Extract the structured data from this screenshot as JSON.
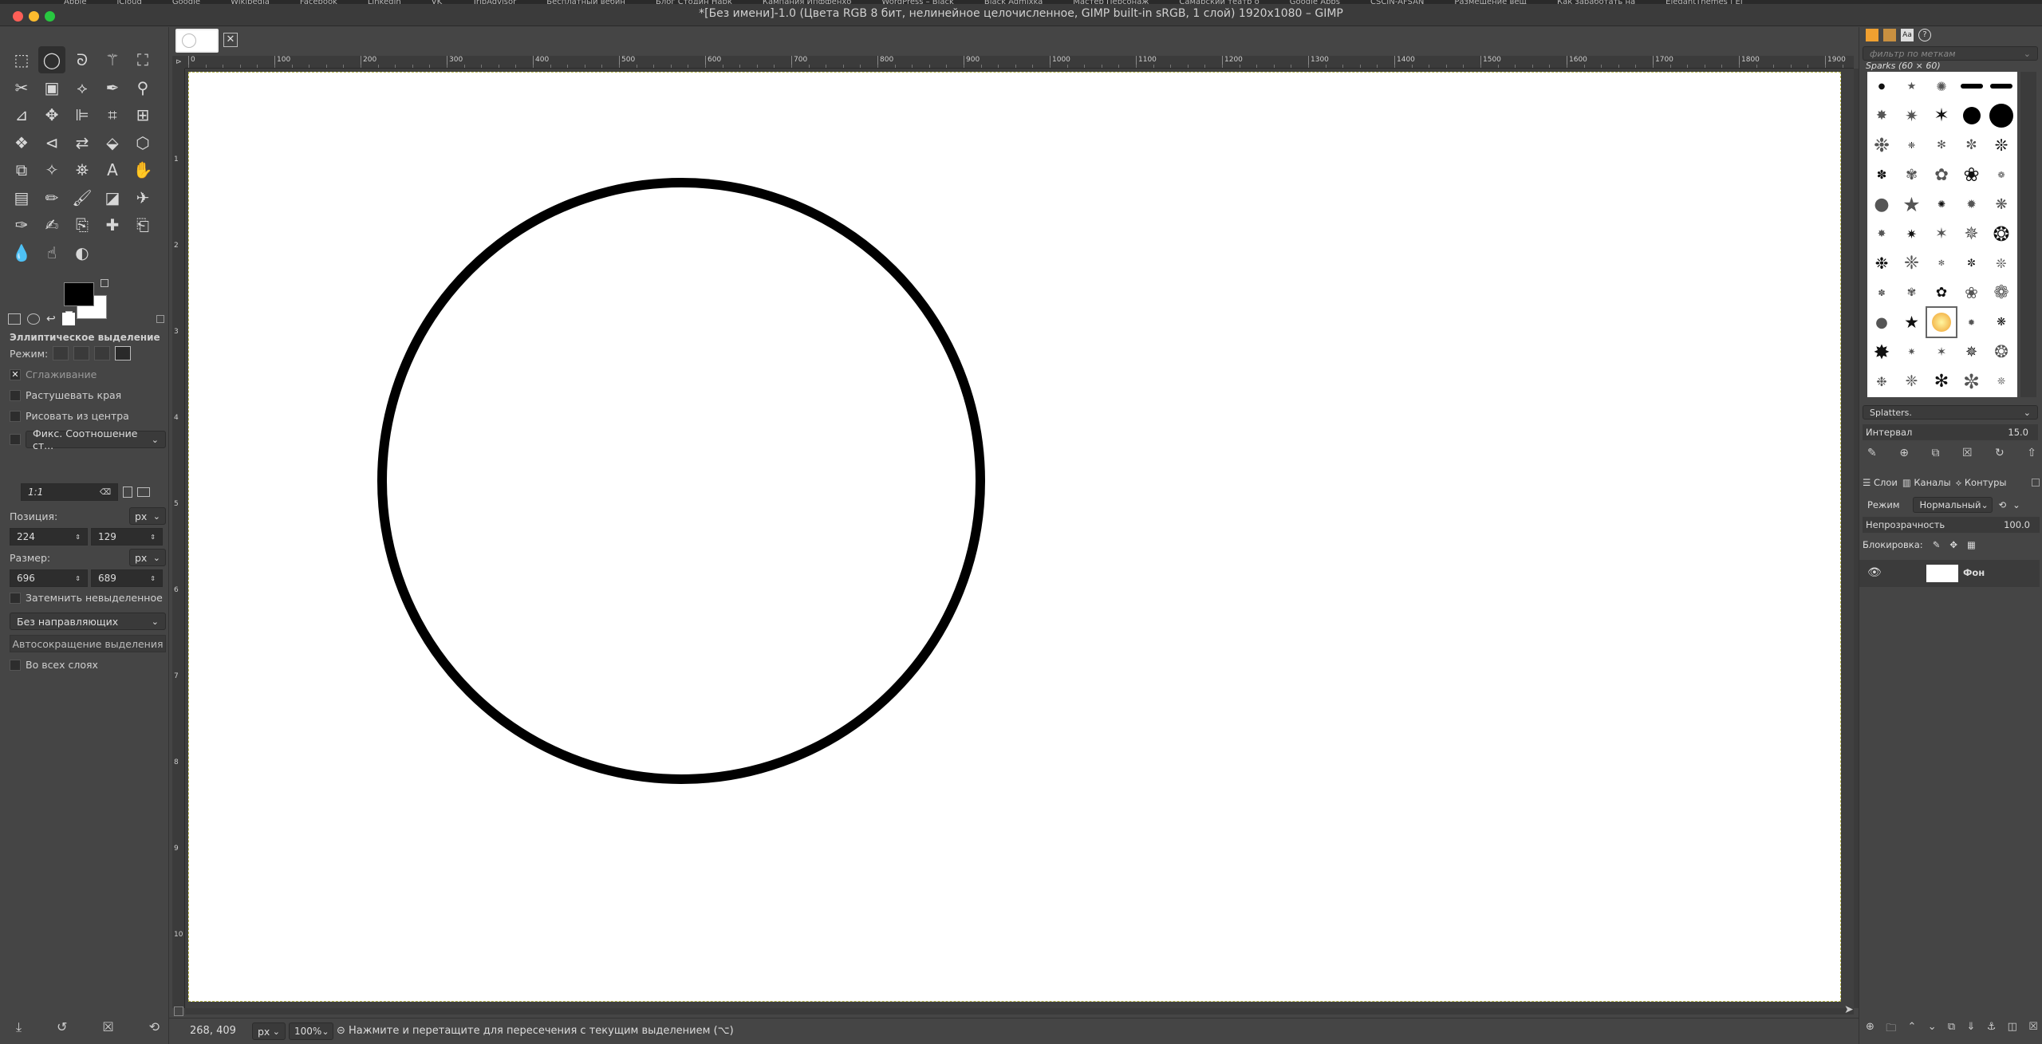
{
  "bookmarks": [
    "Apple",
    "iCloud",
    "Google",
    "Wikipedia",
    "Facebook",
    "LinkedIn",
    "VK",
    "TripAdvisor",
    "Бесплатный вебин",
    "Блог Стодин Нарк",
    "Кампания Ипффенхо",
    "WordPress – Black",
    "Black Admixka",
    "Мастер Персонаж",
    "Самарский театр о",
    "Google Apps",
    "CSCIN-AFSAN",
    "Размещение вещ",
    "Как заработать на",
    "ElegantThemes | El"
  ],
  "window": {
    "title": "*[Без имени]-1.0 (Цвета RGB 8 бит, нелинейное целочисленное, GIMP built-in sRGB, 1 слой) 1920x1080 – GIMP",
    "colors": {
      "close": "#fe5f57",
      "minimize": "#febc2e",
      "zoom": "#28c840"
    }
  },
  "toolbox": {
    "tools": [
      [
        "rect-select-icon",
        "ellipse-select-icon",
        "free-select-icon",
        "fuzzy-select-icon",
        "select-by-color-icon"
      ],
      [
        "scissors-select-icon",
        "foreground-select-icon",
        "paths-icon",
        "color-picker-icon",
        "zoom-icon"
      ],
      [
        "measure-icon",
        "move-icon",
        "align-icon",
        "crop-icon",
        "unified-transform-icon"
      ],
      [
        "warp-transform-icon",
        "cage-transform-icon",
        "flip-icon",
        "handle-transform-icon",
        "perspective-icon"
      ],
      [
        "seamless-clone-icon",
        "gegl-graph-icon",
        "bucket-fill-icon",
        "text-icon",
        "paint-select-icon"
      ],
      [
        "gradient-icon",
        "pencil-icon",
        "paintbrush-icon",
        "eraser-icon",
        "airbrush-icon"
      ],
      [
        "ink-icon",
        "mypaint-brush-icon",
        "clone-icon",
        "heal-icon",
        "perspective-clone-icon"
      ],
      [
        "blur-icon",
        "smudge-icon",
        "dodge-burn-icon"
      ]
    ],
    "options": {
      "title": "Эллиптическое выделение",
      "mode_label": "Режим:",
      "antialias": "Сглаживание",
      "feather": "Растушевать края",
      "from_center": "Рисовать из центра",
      "fixed": "Фикс. Соотношение ст...",
      "ratio": "1:1",
      "position_label": "Позиция:",
      "position_unit": "px",
      "position_x": "224",
      "position_y": "129",
      "size_label": "Размер:",
      "size_unit": "px",
      "size_w": "696",
      "size_h": "689",
      "highlight": "Затемнить невыделенное",
      "guides": "Без направляющих",
      "autoshrink": "Автосокращение выделения",
      "all_layers": "Во всех слоях"
    }
  },
  "rulers": {
    "h_ticks": [
      "0",
      "100",
      "200",
      "300",
      "400",
      "500",
      "600",
      "700",
      "800",
      "900",
      "1000",
      "1100",
      "1200",
      "1300",
      "1400",
      "1500",
      "1600",
      "1700",
      "1800",
      "1900"
    ],
    "v_ticks": [
      "1",
      "2",
      "3",
      "4",
      "5",
      "6",
      "7",
      "8",
      "9",
      "10"
    ]
  },
  "status": {
    "coords": "268, 409",
    "unit": "px",
    "zoom": "100%",
    "message": "Нажмите и перетащите для пересечения с текущим выделением (⌥)"
  },
  "dock": {
    "filter_placeholder": "фильтр по меткам",
    "brush_name": "Sparks (60 × 60)",
    "brush_category": "Splatters.",
    "interval_label": "Интервал",
    "interval_value": "15.0",
    "tab_layers": "Слои",
    "tab_channels": "Каналы",
    "tab_paths": "Контуры",
    "mode_label": "Режим",
    "mode_value": "Нормальный",
    "opacity_label": "Непрозрачность",
    "opacity_value": "100.0",
    "lock_label": "Блокировка:",
    "layer_name": "Фон"
  }
}
